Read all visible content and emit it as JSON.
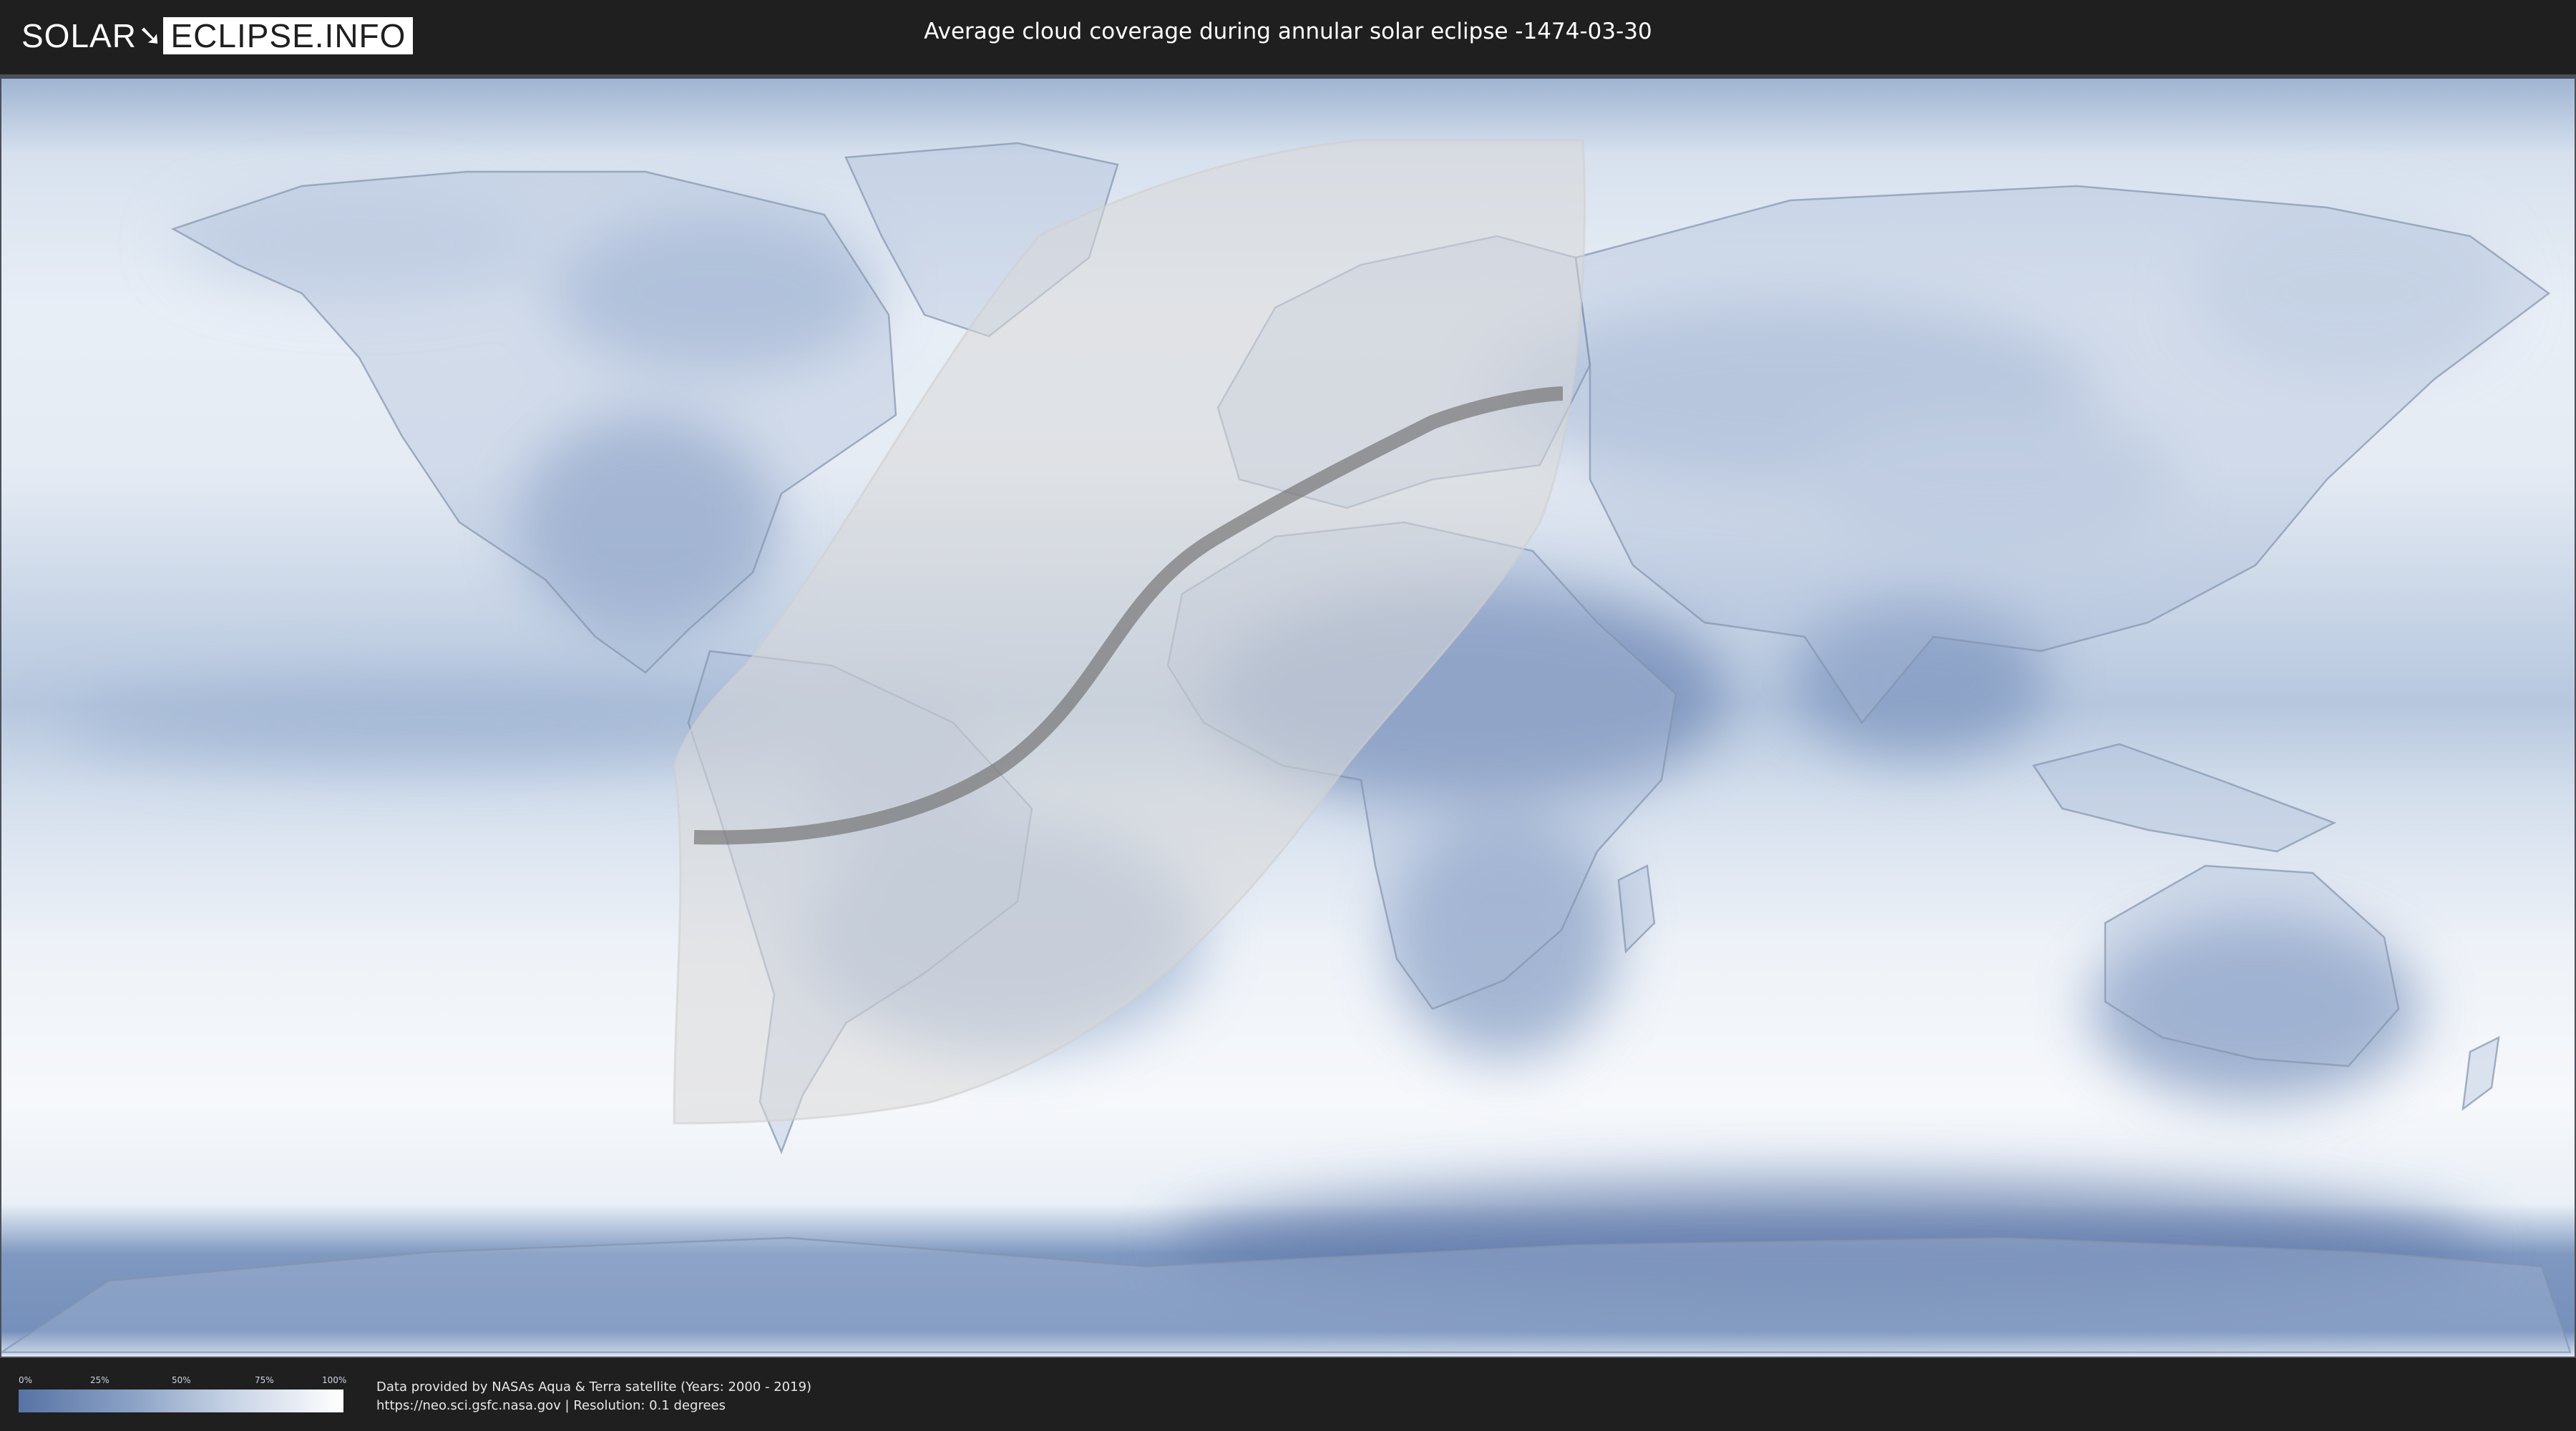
{
  "header": {
    "logo": {
      "part1": "SOLAR",
      "part2": "ECLIPSE.INFO"
    },
    "title": "Average cloud coverage during annular solar eclipse -1474-03-30"
  },
  "legend": {
    "ticks": [
      "0%",
      "25%",
      "50%",
      "75%",
      "100%"
    ],
    "gradient_colors": [
      "#5873a4",
      "#8ba2c6",
      "#c6d2e4",
      "#ffffff"
    ]
  },
  "footer": {
    "credit_line1": "Data provided by NASAs Aqua & Terra satellite (Years: 2000 - 2019)",
    "credit_line2": "https://neo.sci.gsfc.nasa.gov | Resolution: 0.1 degrees"
  },
  "map": {
    "colors": {
      "clear_sky": "#5873a4",
      "cloudy": "#ffffff",
      "eclipse_zone": "#d8d8d8",
      "central_line": "#6e6e6e",
      "coastline": "#9aa6b8"
    }
  }
}
